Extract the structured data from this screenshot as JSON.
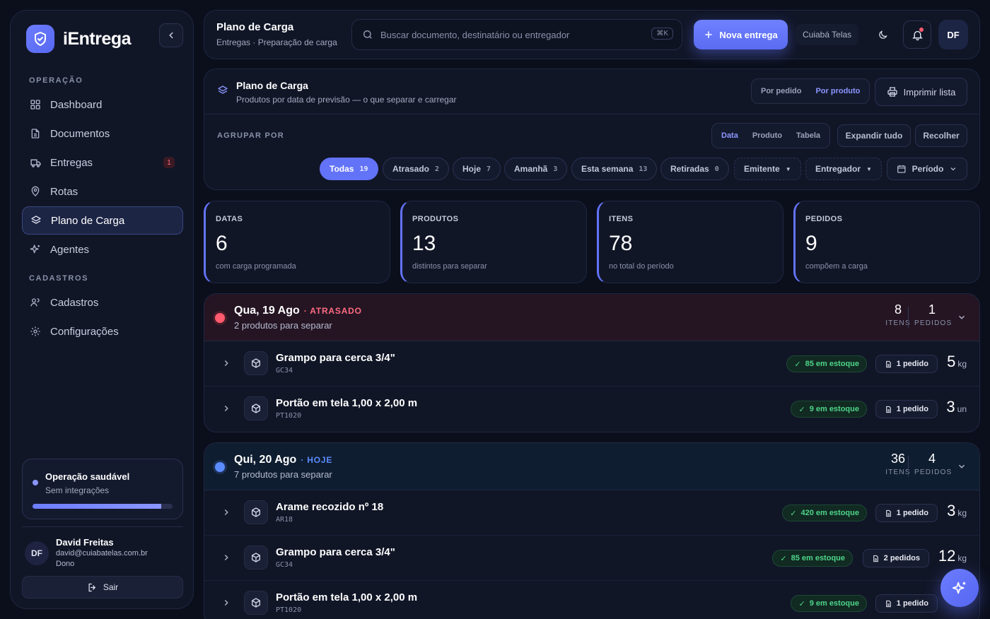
{
  "brand": {
    "name": "iEntrega"
  },
  "sidebar": {
    "section_operacao": "OPERAÇÃO",
    "section_cadastros": "CADASTROS",
    "items": [
      {
        "label": "Dashboard",
        "icon": "grid-icon"
      },
      {
        "label": "Documentos",
        "icon": "document-icon"
      },
      {
        "label": "Entregas",
        "icon": "truck-icon",
        "badge": "1"
      },
      {
        "label": "Rotas",
        "icon": "map-pin-icon"
      },
      {
        "label": "Plano de Carga",
        "icon": "layers-icon",
        "active": true
      },
      {
        "label": "Agentes",
        "icon": "sparkles-icon"
      },
      {
        "label": "Cadastros",
        "icon": "users-icon"
      },
      {
        "label": "Configurações",
        "icon": "gear-icon"
      }
    ],
    "health": {
      "title": "Operação saudável",
      "subtitle": "Sem integrações",
      "progress_percent": 92
    },
    "user": {
      "initials": "DF",
      "name": "David Freitas",
      "email": "david@cuiabatelas.com.br",
      "role": "Dono"
    },
    "logout_label": "Sair"
  },
  "topbar": {
    "title": "Plano de Carga",
    "breadcrumb": "Entregas · Preparação de carga",
    "search_placeholder": "Buscar documento, destinatário ou entregador",
    "shortcut": "⌘K",
    "new_button": "Nova entrega",
    "org": "Cuiabá Telas",
    "avatar": "DF"
  },
  "panel": {
    "title": "Plano de Carga",
    "subtitle": "Produtos por data de previsão — o que separar e carregar",
    "view_toggle": [
      "Por pedido",
      "Por produto"
    ],
    "print_label": "Imprimir lista",
    "group_label": "AGRUPAR POR",
    "group_toggle": [
      "Data",
      "Produto",
      "Tabela"
    ],
    "expand_label": "Expandir tudo",
    "collapse_label": "Recolher",
    "filters": [
      {
        "label": "Todas",
        "count": "19"
      },
      {
        "label": "Atrasado",
        "count": "2"
      },
      {
        "label": "Hoje",
        "count": "7"
      },
      {
        "label": "Amanhã",
        "count": "3"
      },
      {
        "label": "Esta semana",
        "count": "13"
      },
      {
        "label": "Retiradas",
        "count": "0"
      }
    ],
    "dropdowns": [
      "Emitente",
      "Entregador",
      "Período"
    ]
  },
  "stats": [
    {
      "label": "DATAS",
      "value": "6",
      "sub": "com carga programada"
    },
    {
      "label": "PRODUTOS",
      "value": "13",
      "sub": "distintos para separar"
    },
    {
      "label": "ITENS",
      "value": "78",
      "sub": "no total do período"
    },
    {
      "label": "PEDIDOS",
      "value": "9",
      "sub": "compõem a carga"
    }
  ],
  "groups": [
    {
      "title": "Qua, 19 Ago",
      "tag": "· ATRASADO",
      "subtitle": "2 produtos para separar",
      "items_count": "8",
      "items_label": "ITENS",
      "orders_count": "1",
      "orders_label": "PEDIDOS",
      "rows": [
        {
          "name": "Grampo para cerca 3/4\"",
          "code": "GC34",
          "stock": "85 em estoque",
          "orders": "1 pedido",
          "qty": "5",
          "unit": "kg"
        },
        {
          "name": "Portão em tela 1,00 x 2,00 m",
          "code": "PT1020",
          "stock": "9 em estoque",
          "orders": "1 pedido",
          "qty": "3",
          "unit": "un"
        }
      ]
    },
    {
      "title": "Qui, 20 Ago",
      "tag": "· HOJE",
      "subtitle": "7 produtos para separar",
      "items_count": "36",
      "items_label": "ITENS",
      "orders_count": "4",
      "orders_label": "PEDIDOS",
      "rows": [
        {
          "name": "Arame recozido nº 18",
          "code": "AR18",
          "stock": "420 em estoque",
          "orders": "1 pedido",
          "qty": "3",
          "unit": "kg"
        },
        {
          "name": "Grampo para cerca 3/4\"",
          "code": "GC34",
          "stock": "85 em estoque",
          "orders": "2 pedidos",
          "qty": "12",
          "unit": "kg"
        },
        {
          "name": "Portão em tela 1,00 x 2,00 m",
          "code": "PT1020",
          "stock": "9 em estoque",
          "orders": "1 pedido",
          "qty": "",
          "unit": ""
        }
      ]
    }
  ],
  "colors": {
    "accent": "#6373f7",
    "late": "#ff5b6e",
    "today": "#5b8cff",
    "stock": "#4ed58a"
  }
}
